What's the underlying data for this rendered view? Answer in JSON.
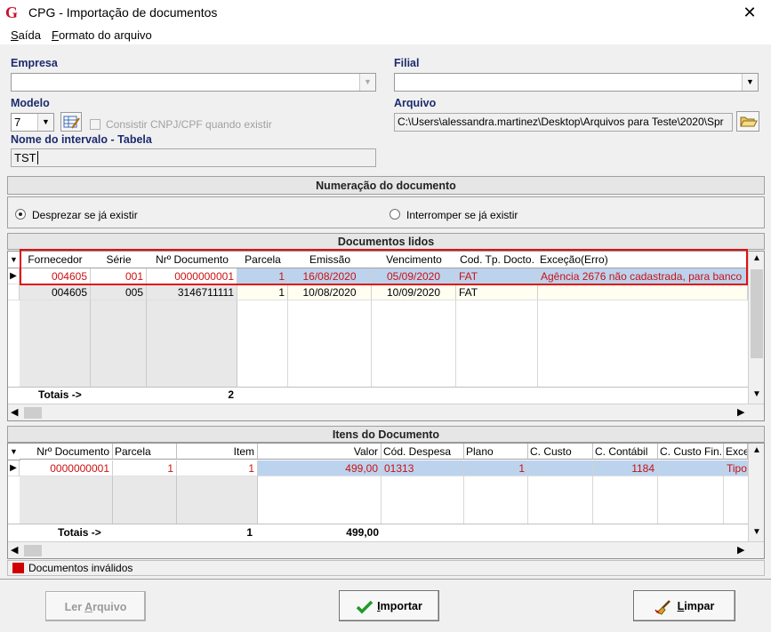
{
  "window": {
    "title": "CPG - Importação de documentos",
    "close": "✕"
  },
  "menu": {
    "exit_pre": "",
    "exit_ul": "S",
    "exit_post": "aída",
    "format_ul": "F",
    "format_post": "ormato do arquivo"
  },
  "form": {
    "empresa_label": "Empresa",
    "empresa_value": "",
    "filial_label": "Filial",
    "filial_value": "",
    "modelo_label": "Modelo",
    "modelo_value": "7",
    "consistir_label": "Consistir CNPJ/CPF quando existir",
    "arquivo_label": "Arquivo",
    "arquivo_value": "C:\\Users\\alessandra.martinez\\Desktop\\Arquivos para Teste\\2020\\Spr",
    "intervalo_label": "Nome do intervalo - Tabela",
    "intervalo_value": "TST"
  },
  "numeracao": {
    "title": "Numeração do documento",
    "opt1": "Desprezar se já existir",
    "opt2": "Interromper se já existir"
  },
  "docs": {
    "title": "Documentos lidos",
    "headers": [
      "Fornecedor",
      "Série",
      "Nrº Documento",
      "Parcela",
      "Emissão",
      "Vencimento",
      "Cod. Tp. Docto.",
      "Exceção(Erro)"
    ],
    "rows": [
      [
        "004605",
        "001",
        "0000000001",
        "1",
        "16/08/2020",
        "05/09/2020",
        "FAT",
        "Agência 2676 não cadastrada,  para banco"
      ],
      [
        "004605",
        "005",
        "3146711111",
        "1",
        "10/08/2020",
        "10/09/2020",
        "FAT",
        ""
      ]
    ],
    "totals_label": "Totais ->",
    "totals_value": "2"
  },
  "itens": {
    "title": "Itens do Documento",
    "headers": [
      "Nrº Documento",
      "Parcela",
      "Item",
      "Valor",
      "Cód. Despesa",
      "Plano",
      "C. Custo",
      "C. Contábil",
      "C. Custo Fin.",
      "Exce"
    ],
    "rows": [
      [
        "0000000001",
        "1",
        "1",
        "499,00",
        "01313",
        "1",
        "",
        "1184",
        "",
        "Tipo"
      ]
    ],
    "totals_label": "Totais ->",
    "totals_item": "1",
    "totals_valor": "499,00"
  },
  "legend": {
    "invalid": "Documentos inválidos",
    "color": "#d00000"
  },
  "buttons": {
    "ler_ul": "A",
    "ler_pre": "Ler ",
    "ler_post": "rquivo",
    "importar_ul": "I",
    "importar_post": "mportar",
    "limpar_ul": "L",
    "limpar_post": "impar"
  }
}
